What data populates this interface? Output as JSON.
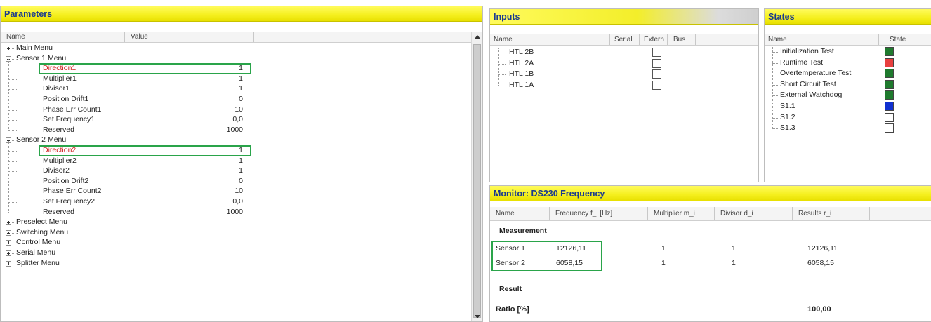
{
  "parameters": {
    "title": "Parameters",
    "col_name": "Name",
    "col_value": "Value",
    "menus": [
      {
        "label": "Main Menu",
        "expanded": false
      },
      {
        "label": "Sensor 1 Menu",
        "expanded": true
      },
      {
        "label": "Sensor 2 Menu",
        "expanded": true
      },
      {
        "label": "Preselect Menu",
        "expanded": false
      },
      {
        "label": "Switching Menu",
        "expanded": false
      },
      {
        "label": "Control Menu",
        "expanded": false
      },
      {
        "label": "Serial Menu",
        "expanded": false
      },
      {
        "label": "Splitter Menu",
        "expanded": false
      }
    ],
    "sensor1_items": [
      {
        "name": "Direction1",
        "value": "1",
        "highlight": true
      },
      {
        "name": "Multiplier1",
        "value": "1"
      },
      {
        "name": "Divisor1",
        "value": "1"
      },
      {
        "name": "Position Drift1",
        "value": "0"
      },
      {
        "name": "Phase Err Count1",
        "value": "10"
      },
      {
        "name": "Set Frequency1",
        "value": "0,0"
      },
      {
        "name": "Reserved",
        "value": "1000"
      }
    ],
    "sensor2_items": [
      {
        "name": "Direction2",
        "value": "1",
        "highlight": true
      },
      {
        "name": "Multiplier2",
        "value": "1"
      },
      {
        "name": "Divisor2",
        "value": "1"
      },
      {
        "name": "Position Drift2",
        "value": "0"
      },
      {
        "name": "Phase Err Count2",
        "value": "10"
      },
      {
        "name": "Set Frequency2",
        "value": "0,0"
      },
      {
        "name": "Reserved",
        "value": "1000"
      }
    ]
  },
  "inputs": {
    "title": "Inputs",
    "columns": [
      "Name",
      "Serial",
      "Extern",
      "Bus"
    ],
    "rows": [
      {
        "name": "HTL 2B",
        "extern_checked": false
      },
      {
        "name": "HTL 2A",
        "extern_checked": false
      },
      {
        "name": "HTL 1B",
        "extern_checked": false
      },
      {
        "name": "HTL 1A",
        "extern_checked": false
      }
    ]
  },
  "states": {
    "title": "States",
    "columns": [
      "Name",
      "State"
    ],
    "rows": [
      {
        "name": "Initialization Test",
        "color": "#1f7a2e"
      },
      {
        "name": "Runtime Test",
        "color": "#e8403f"
      },
      {
        "name": "Overtemperature Test",
        "color": "#1f7a2e"
      },
      {
        "name": "Short Circuit Test",
        "color": "#1f7a2e"
      },
      {
        "name": "External Watchdog",
        "color": "#1f7a2e"
      },
      {
        "name": "S1.1",
        "color": "#1030d0"
      },
      {
        "name": "S1.2",
        "color": "#ffffff"
      },
      {
        "name": "S1.3",
        "color": "#ffffff"
      }
    ]
  },
  "monitor": {
    "title": "Monitor: DS230 Frequency",
    "columns": [
      "Name",
      "Frequency f_i [Hz]",
      "Multiplier m_i",
      "Divisor d_i",
      "Results r_i"
    ],
    "measurement_label": "Measurement",
    "rows": [
      {
        "name": "Sensor 1",
        "frequency": "12126,11",
        "multiplier": "1",
        "divisor": "1",
        "result": "12126,11"
      },
      {
        "name": "Sensor 2",
        "frequency": "6058,15",
        "multiplier": "1",
        "divisor": "1",
        "result": "6058,15"
      }
    ],
    "result_label": "Result",
    "ratio_label": "Ratio [%]",
    "ratio_value": "100,00"
  }
}
